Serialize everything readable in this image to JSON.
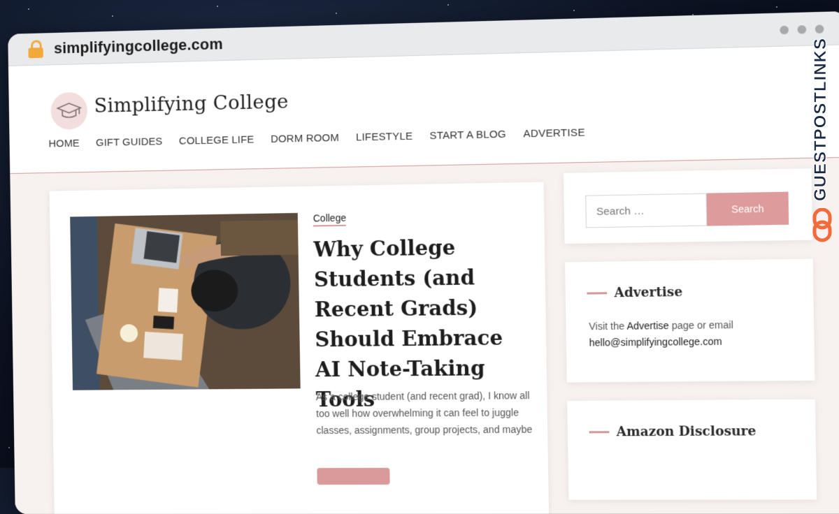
{
  "browser": {
    "url": "simplifyingcollege.com"
  },
  "site": {
    "title": "Simplifying College",
    "nav": [
      "HOME",
      "GIFT GUIDES",
      "COLLEGE LIFE",
      "DORM ROOM",
      "LIFESTYLE",
      "START A BLOG",
      "ADVERTISE"
    ]
  },
  "post": {
    "category": "College",
    "title": "Why College Students (and Recent Grads) Should Embrace AI Note-Taking Tools",
    "excerpt": "As a college student (and recent grad), I know all too well how overwhelming it can feel to juggle classes, assignments, group projects, and maybe"
  },
  "search": {
    "placeholder": "Search …",
    "button_label": "Search"
  },
  "advertise_widget": {
    "title": "Advertise",
    "text_prefix": "Visit the ",
    "link_text": "Advertise",
    "text_suffix": " page or email",
    "email": "hello@simplifyingcollege.com"
  },
  "amazon_widget": {
    "title": "Amazon Disclosure"
  },
  "watermark": {
    "label": "GUESTPOSTLINKS"
  },
  "colors": {
    "accent": "#d29a9a",
    "button": "#dd9b9b",
    "lock": "#f2a93b",
    "watermark": "#1b2a44",
    "watermark_icon": "#f26b3a"
  }
}
